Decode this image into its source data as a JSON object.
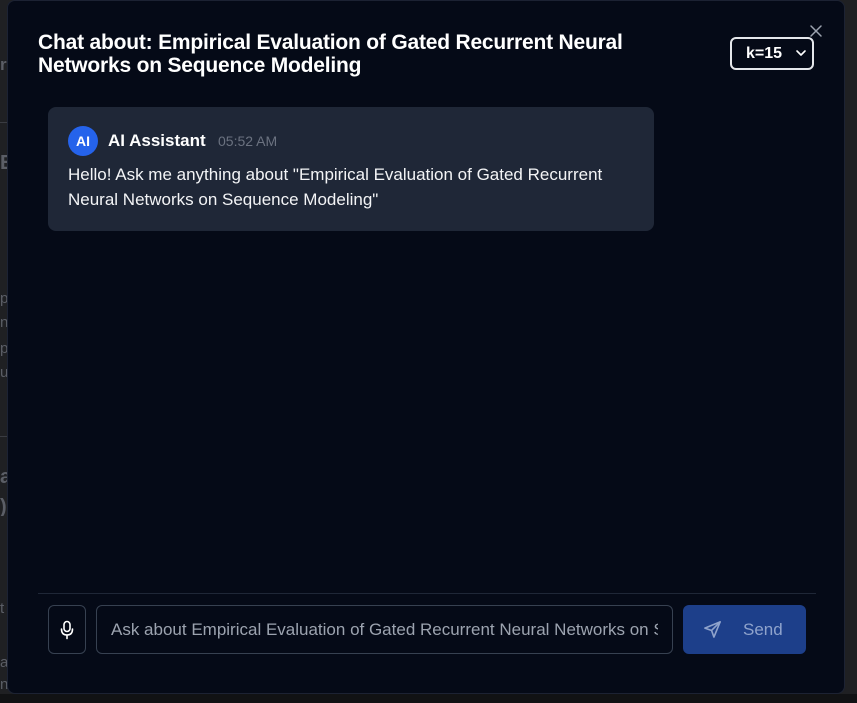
{
  "modal": {
    "title": "Chat about: Empirical Evaluation of Gated Recurrent Neural Networks on Sequence Modeling",
    "k_select": {
      "value": "k=15"
    }
  },
  "messages": [
    {
      "avatar": "AI",
      "sender": "AI Assistant",
      "time": "05:52 AM",
      "text": "Hello! Ask me anything about \"Empirical Evaluation of Gated Recurrent Neural Networks on Sequence Modeling\""
    }
  ],
  "composer": {
    "placeholder": "Ask about Empirical Evaluation of Gated Recurrent Neural Networks on Sequence Modeling...",
    "send_label": "Send"
  },
  "background": {
    "fragments": [
      "r",
      "E",
      "p",
      "n",
      "p",
      "u",
      "a",
      ")",
      "t",
      "a",
      "n"
    ]
  },
  "icons": {
    "close": "close-icon",
    "chevron": "chevron-down-icon",
    "mic": "microphone-icon",
    "send": "send-icon"
  },
  "colors": {
    "modal_bg": "#050a17",
    "bubble_bg": "#1f2737",
    "accent": "#2563eb",
    "send_bg": "#1d3f8a"
  }
}
